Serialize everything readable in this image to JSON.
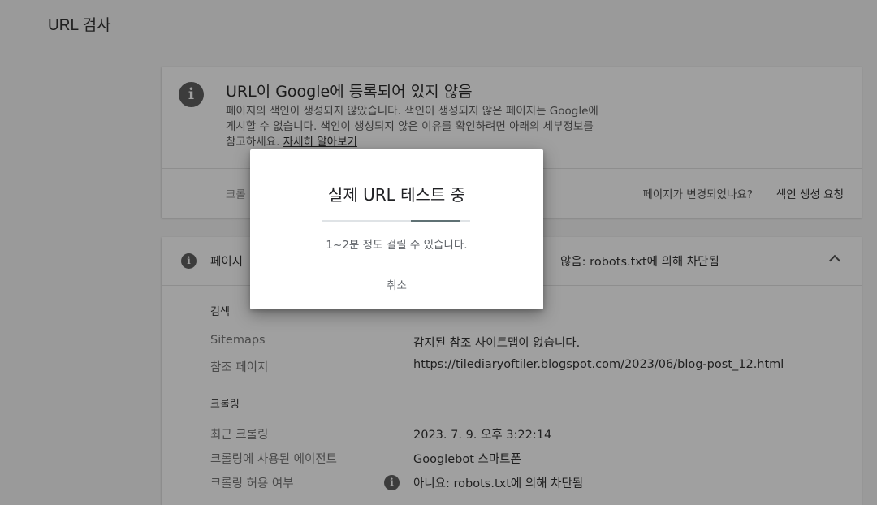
{
  "page": {
    "title": "URL 검사"
  },
  "status_card": {
    "icon": "info-icon",
    "title": "URL이 Google에 등록되어 있지 않음",
    "desc_line1": "페이지의 색인이 생성되지 않았습니다. 색인이 생성되지 않은 페이지는 Google에",
    "desc_line2": "게시할 수 없습니다. 색인이 생성되지 않은 이유를 확인하려면 아래의 세부정보를",
    "desc_line3_prefix": "참고하세요. ",
    "learn_more": "자세히 알아보기",
    "footer_left": "크롤",
    "page_changed_question": "페이지가 변경되었나요?",
    "request_indexing": "색인 생성 요청"
  },
  "details_card": {
    "icon": "info-icon",
    "header_label": "페이지",
    "header_status": "않음: robots.txt에 의해 차단됨",
    "sections": {
      "discovery": {
        "title": "검색",
        "sitemaps_label": "Sitemaps",
        "sitemaps_value": "감지된 참조 사이트맵이 없습니다.",
        "referring_label": "참조 페이지",
        "referring_value": "https://tilediaryoftiler.blogspot.com/2023/06/blog-post_12.html"
      },
      "crawl": {
        "title": "크롤링",
        "last_crawl_label": "최근 크롤링",
        "last_crawl_value": "2023. 7. 9. 오후 3:22:14",
        "user_agent_label": "크롤링에 사용된 에이전트",
        "user_agent_value": "Googlebot 스마트폰",
        "allowed_label": "크롤링 허용 여부",
        "allowed_value": "아니요: robots.txt에 의해 차단됨"
      }
    }
  },
  "modal": {
    "title": "실제 URL 테스트 중",
    "subtitle": "1~2분 정도 걸릴 수 있습니다.",
    "cancel": "취소",
    "progress": {
      "start": 0.6,
      "end": 0.93
    }
  },
  "colors": {
    "scrim_background": "#9a9a9a",
    "card_background": "#a0a0a0",
    "progress_fill": "#5f7174",
    "progress_track": "#dfe3e6"
  }
}
